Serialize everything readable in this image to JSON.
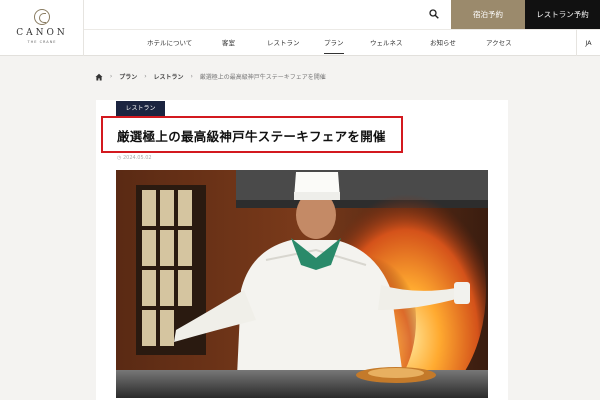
{
  "brand": {
    "name": "CANON",
    "subtitle": "THE CRANE"
  },
  "header": {
    "book_stay_label": "宿泊予約",
    "book_restaurant_label": "レストラン予約",
    "language": "JA"
  },
  "nav": {
    "items": [
      "ホテルについて",
      "客室",
      "レストラン",
      "プラン",
      "ウェルネス",
      "お知らせ",
      "アクセス"
    ],
    "active_index": 3
  },
  "breadcrumb": {
    "items": [
      "プラン",
      "レストラン"
    ],
    "current": "厳選極上の最高級神戸牛ステーキフェアを開催"
  },
  "article": {
    "category": "レストラン",
    "title": "厳選極上の最高級神戸牛ステーキフェアを開催",
    "date": "2024.05.02"
  },
  "colors": {
    "gold_button": "#9b8a6c",
    "dark_button": "#111111",
    "tag_background": "#1b2440",
    "highlight_border": "#d3191f",
    "page_background": "#f4f3f1"
  },
  "icons": {
    "search": "search-icon",
    "home": "home-icon",
    "logo": "logo-mark-icon"
  },
  "photo": {
    "subject": "Chef flambéing at teppanyaki grill"
  }
}
